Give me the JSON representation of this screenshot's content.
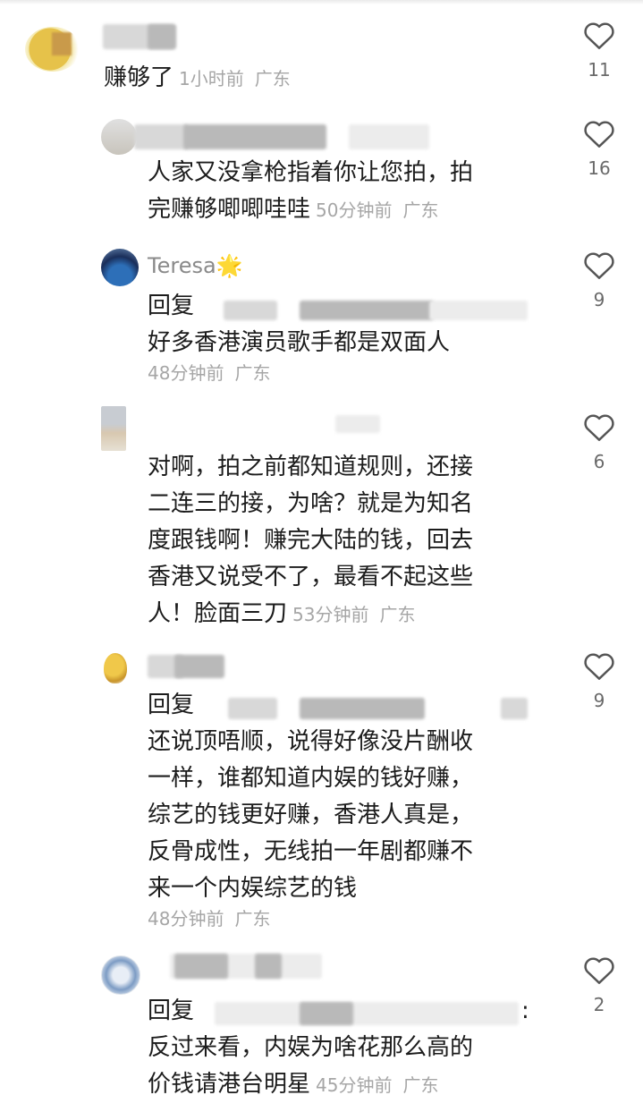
{
  "comments": [
    {
      "text": "赚够了",
      "time": "1小时前",
      "location": "广东",
      "likes": "11"
    },
    {
      "text_lines": [
        "人家又没拿枪指着你让您拍，拍",
        "完赚够唧唧哇哇"
      ],
      "time": "50分钟前",
      "location": "广东",
      "likes": "16"
    },
    {
      "username": "Teresa",
      "username_emoji": "🌟",
      "reply_label": "回复",
      "text": "好多香港演员歌手都是双面人",
      "time": "48分钟前",
      "location": "广东",
      "likes": "9"
    },
    {
      "text_lines": [
        "对啊，拍之前都知道规则，还接",
        "二连三的接，为啥？就是为知名",
        "度跟钱啊！赚完大陆的钱，回去",
        "香港又说受不了，最看不起这些",
        "人！脸面三刀"
      ],
      "time": "53分钟前",
      "location": "广东",
      "likes": "6"
    },
    {
      "reply_label": "回复",
      "text_lines": [
        "还说顶唔顺，说得好像没片酬收",
        "一样，谁都知道内娱的钱好赚，",
        "综艺的钱更好赚，香港人真是，",
        "反骨成性，无线拍一年剧都赚不",
        "来一个内娱综艺的钱"
      ],
      "time": "48分钟前",
      "location": "广东",
      "likes": "9"
    },
    {
      "reply_label": "回复",
      "reply_colon": ":",
      "text_lines": [
        "反过来看，内娱为啥花那么高的",
        "价钱请港台明星"
      ],
      "time": "45分钟前",
      "location": "广东",
      "likes": "2"
    }
  ],
  "icons": {
    "like": "heart-outline-icon"
  },
  "colors": {
    "text": "#1c1c1c",
    "meta": "#a6a6a6",
    "like_stroke": "#555555"
  }
}
